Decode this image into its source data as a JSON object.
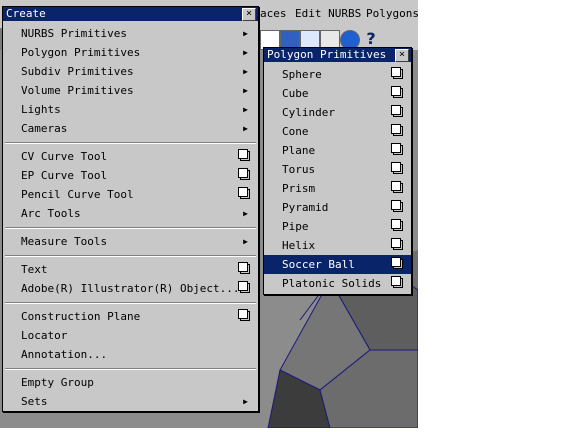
{
  "app_menubar": {
    "items": [
      "aces",
      "Edit NURBS",
      "Polygons"
    ]
  },
  "create_menu": {
    "title": "Create",
    "close": "×",
    "groups": [
      [
        {
          "label": "NURBS Primitives",
          "type": "submenu"
        },
        {
          "label": "Polygon Primitives",
          "type": "submenu"
        },
        {
          "label": "Subdiv Primitives",
          "type": "submenu"
        },
        {
          "label": "Volume Primitives",
          "type": "submenu"
        },
        {
          "label": "Lights",
          "type": "submenu"
        },
        {
          "label": "Cameras",
          "type": "submenu"
        }
      ],
      [
        {
          "label": "CV Curve Tool",
          "type": "option"
        },
        {
          "label": "EP Curve Tool",
          "type": "option"
        },
        {
          "label": "Pencil Curve Tool",
          "type": "option"
        },
        {
          "label": "Arc Tools",
          "type": "submenu"
        }
      ],
      [
        {
          "label": "Measure Tools",
          "type": "submenu"
        }
      ],
      [
        {
          "label": "Text",
          "type": "option"
        },
        {
          "label": "Adobe(R) Illustrator(R) Object...",
          "type": "option"
        }
      ],
      [
        {
          "label": "Construction Plane",
          "type": "option"
        },
        {
          "label": "Locator",
          "type": "plain"
        },
        {
          "label": "Annotation...",
          "type": "plain"
        }
      ],
      [
        {
          "label": "Empty Group",
          "type": "plain"
        },
        {
          "label": "Sets",
          "type": "submenu"
        }
      ]
    ]
  },
  "poly_menu": {
    "title": "Polygon Primitives",
    "close": "×",
    "items": [
      "Sphere",
      "Cube",
      "Cylinder",
      "Cone",
      "Plane",
      "Torus",
      "Prism",
      "Pyramid",
      "Pipe",
      "Helix",
      "Soccer Ball",
      "Platonic Solids"
    ],
    "selected": "Soccer Ball"
  }
}
